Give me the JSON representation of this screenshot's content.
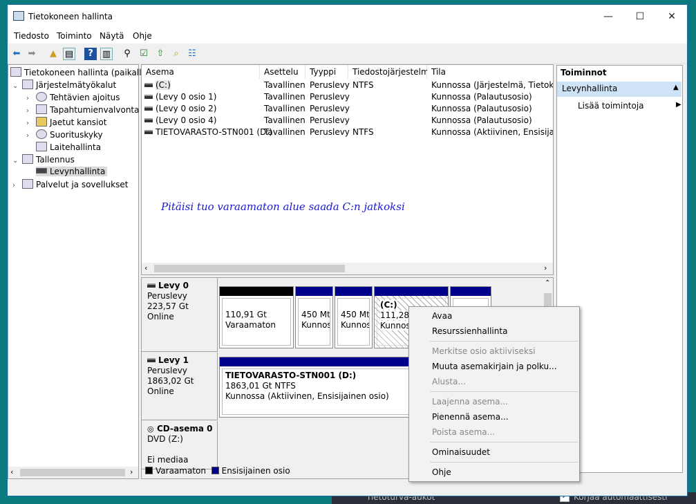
{
  "window": {
    "title": "Tietokoneen hallinta"
  },
  "menu": [
    "Tiedosto",
    "Toiminto",
    "Näytä",
    "Ohje"
  ],
  "tree": {
    "root": "Tietokoneen hallinta (paikalline",
    "sys_tools": "Järjestelmätyökalut",
    "scheduler": "Tehtävien ajoitus",
    "event_viewer": "Tapahtumienvalvonta",
    "shared_folders": "Jaetut kansiot",
    "performance": "Suorituskyky",
    "device_manager": "Laitehallinta",
    "storage": "Tallennus",
    "disk_mgmt": "Levynhallinta",
    "services": "Palvelut ja sovellukset"
  },
  "list": {
    "headers": [
      "Asema",
      "Asettelu",
      "Tyyppi",
      "Tiedostojärjestelmä",
      "Tila"
    ],
    "rows": [
      [
        "(C:)",
        "Tavallinen",
        "Peruslevy",
        "NTFS",
        "Kunnossa (Järjestelmä, Tietokone"
      ],
      [
        "(Levy 0 osio 1)",
        "Tavallinen",
        "Peruslevy",
        "",
        "Kunnossa (Palautusosio)"
      ],
      [
        "(Levy 0 osio 2)",
        "Tavallinen",
        "Peruslevy",
        "",
        "Kunnossa (Palautusosio)"
      ],
      [
        "(Levy 0 osio 4)",
        "Tavallinen",
        "Peruslevy",
        "",
        "Kunnossa (Palautusosio)"
      ],
      [
        "TIETOVARASTO-STN001 (D:)",
        "Tavallinen",
        "Peruslevy",
        "NTFS",
        "Kunnossa (Aktiivinen, Ensisijainen"
      ]
    ],
    "annotation": "Pitäisi tuo varaamaton alue saada C:n jatkoksi"
  },
  "disks": {
    "disk0": {
      "name": "Levy 0",
      "type": "Peruslevy",
      "size": "223,57 Gt",
      "status": "Online",
      "p1_size": "110,91 Gt",
      "p1_label": "Varaamaton",
      "p2_size": "450 Mt",
      "p2_label": "Kunnos",
      "p3_size": "450 Mt",
      "p3_label": "Kunnos",
      "p4_name": "(C:)",
      "p4_size": "111,28 G",
      "p4_label": "Kunnoss"
    },
    "disk1": {
      "name": "Levy 1",
      "type": "Peruslevy",
      "size": "1863,02 Gt",
      "status": "Online",
      "p_name": "TIETOVARASTO-STN001  (D:)",
      "p_size": "1863,01 Gt NTFS",
      "p_status": "Kunnossa (Aktiivinen, Ensisijainen osio)"
    },
    "cd": {
      "name": "CD-asema 0",
      "type": "DVD (Z:)",
      "status": "Ei mediaa"
    }
  },
  "legend": {
    "unallocated": "Varaamaton",
    "primary": "Ensisijainen osio"
  },
  "actions": {
    "header": "Toiminnot",
    "selected": "Levynhallinta",
    "more": "Lisää toimintoja"
  },
  "context_menu": {
    "open": "Avaa",
    "explore": "Resurssienhallinta",
    "mark_active": "Merkitse osio aktiiviseksi",
    "change_letter": "Muuta asemakirjain ja polku...",
    "format": "Alusta...",
    "extend": "Laajenna asema...",
    "shrink": "Pienennä asema...",
    "delete": "Poista asema...",
    "properties": "Ominaisuudet",
    "help": "Ohje"
  },
  "desktop": {
    "taskbar_text": "Tietoturva-aukot",
    "taskbar_text2": "Korjaa automaattisesti"
  },
  "colors": {
    "primary_partition": "#00008b",
    "unallocated": "#000000",
    "selection": "#cfe3f7"
  }
}
